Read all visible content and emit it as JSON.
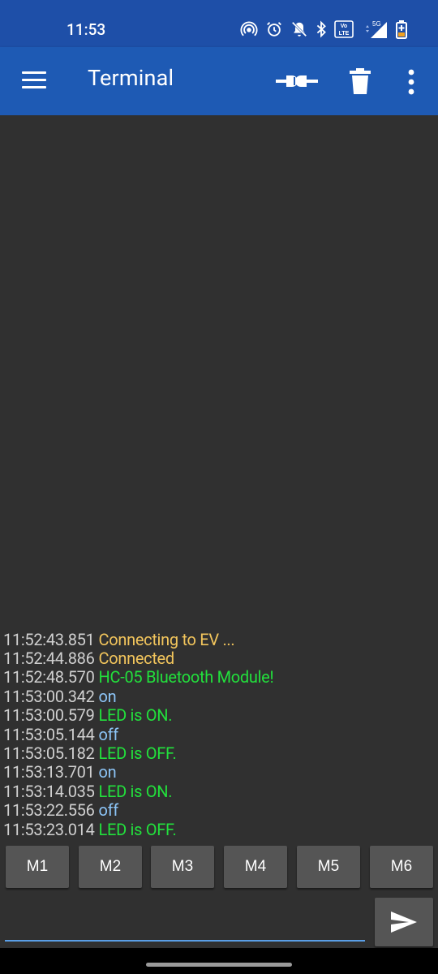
{
  "status_bar": {
    "time": "11:53",
    "icons": [
      "hotspot-icon",
      "alarm-icon",
      "mute-bell-icon",
      "bluetooth-icon",
      "volte-icon",
      "signal-5g-icon",
      "battery-charging-icon"
    ],
    "volte_label": "Vo LTE",
    "network": "5G"
  },
  "app_bar": {
    "title": "Terminal",
    "actions": [
      "connect-icon",
      "delete-icon",
      "overflow-menu-icon"
    ]
  },
  "log": [
    {
      "time": "11:52:43.851",
      "text": "Connecting to EV ...",
      "kind": "status"
    },
    {
      "time": "11:52:44.886",
      "text": "Connected",
      "kind": "status"
    },
    {
      "time": "11:52:48.570",
      "text": "HC-05 Bluetooth Module!",
      "kind": "received"
    },
    {
      "time": "11:53:00.342",
      "text": "on",
      "kind": "sent"
    },
    {
      "time": "11:53:00.579",
      "text": "LED is ON.",
      "kind": "received"
    },
    {
      "time": "11:53:05.144",
      "text": "off",
      "kind": "sent"
    },
    {
      "time": "11:53:05.182",
      "text": "LED is OFF.",
      "kind": "received"
    },
    {
      "time": "11:53:13.701",
      "text": "on",
      "kind": "sent"
    },
    {
      "time": "11:53:14.035",
      "text": "LED is ON.",
      "kind": "received"
    },
    {
      "time": "11:53:22.556",
      "text": "off",
      "kind": "sent"
    },
    {
      "time": "11:53:23.014",
      "text": "LED is OFF.",
      "kind": "received"
    }
  ],
  "macros": [
    "M1",
    "M2",
    "M3",
    "M4",
    "M5",
    "M6"
  ],
  "input": {
    "value": "",
    "placeholder": ""
  },
  "colors": {
    "status_bar": "#1e4fa8",
    "app_bar": "#1e5ab4",
    "terminal_bg": "#303030",
    "status_text": "#f2c55c",
    "received_text": "#22e03c",
    "sent_text": "#8cc4f6",
    "timestamp_text": "#d0d0d0",
    "macro_button": "#555555",
    "input_underline": "#5a9ee6"
  }
}
